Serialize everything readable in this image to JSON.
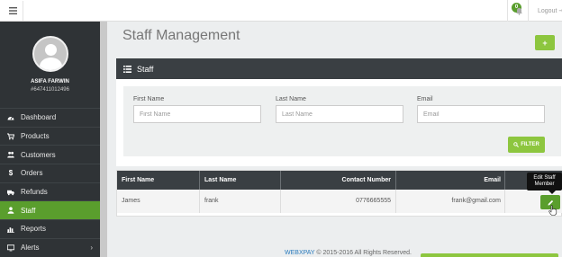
{
  "topbar": {
    "notification_count": "0",
    "logout_label": "Logout"
  },
  "user": {
    "name": "ASIFA FARWIN",
    "id": "#647411012496"
  },
  "nav": {
    "items": [
      {
        "label": "Dashboard",
        "icon": "dashboard-icon"
      },
      {
        "label": "Products",
        "icon": "cart-icon"
      },
      {
        "label": "Customers",
        "icon": "users-icon"
      },
      {
        "label": "Orders",
        "icon": "dollar-icon"
      },
      {
        "label": "Refunds",
        "icon": "truck-icon"
      },
      {
        "label": "Staff",
        "icon": "user-icon",
        "active": true
      },
      {
        "label": "Reports",
        "icon": "bar-chart-icon"
      },
      {
        "label": "Alerts",
        "icon": "monitor-icon"
      }
    ]
  },
  "page": {
    "title": "Staff Management",
    "add_label": "+"
  },
  "panel": {
    "title": "Staff"
  },
  "filters": {
    "first_name_label": "First Name",
    "first_name_placeholder": "First Name",
    "last_name_label": "Last Name",
    "last_name_placeholder": "Last Name",
    "email_label": "Email",
    "email_placeholder": "Email",
    "filter_label": "FILTER"
  },
  "table": {
    "headers": {
      "first_name": "First Name",
      "last_name": "Last Name",
      "contact": "Contact Number",
      "email": "Email"
    },
    "rows": [
      {
        "first_name": "James",
        "last_name": "frank",
        "contact": "0776665555",
        "email": "frank@gmail.com"
      }
    ],
    "edit_tooltip_1": "Edit Staff",
    "edit_tooltip_2": "Member"
  },
  "footer": {
    "brand": "WEBXPAY",
    "text": " © 2015-2016 All Rights Reserved."
  },
  "colors": {
    "accent_green": "#8dc63f",
    "active_green": "#5a9e2d",
    "sidebar_bg": "#2f3336",
    "header_dark": "#3a3f43"
  }
}
